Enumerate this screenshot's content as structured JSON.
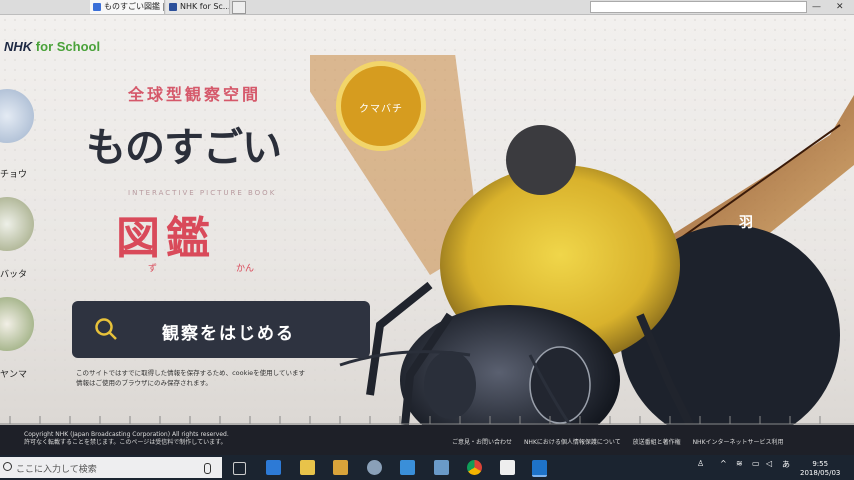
{
  "browser": {
    "tabs": [
      {
        "label": "ものすごい図鑑 | NHK for Sc..."
      },
      {
        "label": "NHK for Sc..."
      }
    ],
    "new_tab_icon": "new-tab-icon"
  },
  "page": {
    "brand": {
      "nhk": "NHK",
      "for_school": "for School"
    },
    "sidebar": [
      {
        "label": "チョウ"
      },
      {
        "label": "バッタ"
      },
      {
        "label": "ヤンマ"
      }
    ],
    "catchcopy": "全球型観察空間",
    "title": "ものすごい",
    "subtitle": "INTERACTIVE PICTURE BOOK",
    "zukan": "図鑑",
    "ruby": {
      "zu": "ず",
      "kan": "かん"
    },
    "start_button": {
      "label": "観察をはじめる",
      "icon": "search-icon"
    },
    "notes": [
      "このサイトではすでに取得した情報を保存するため、cookieを使用しています",
      "情報はご使用のブラウザにのみ保存されます。"
    ],
    "hotspots": {
      "species": "クマバチ",
      "wing": "羽"
    }
  },
  "footer": {
    "copyright_1": "Copyright NHK (Japan Broadcasting Corporation) All rights reserved.",
    "copyright_2": "許可なく転載することを禁じます。このページは受信料で制作しています。",
    "links": [
      "ご意見・お問い合わせ",
      "NHKにおける個人情報保護について",
      "放送番組と著作権",
      "NHKインターネットサービス利用"
    ]
  },
  "taskbar": {
    "search_placeholder": "ここに入力して検索",
    "ime": "あ",
    "time": "9:55",
    "date": "2018/05/03"
  },
  "colors": {
    "accent_red": "#d94a5a",
    "dark_button": "#2e3340",
    "nhk_green": "#4aa23a"
  }
}
